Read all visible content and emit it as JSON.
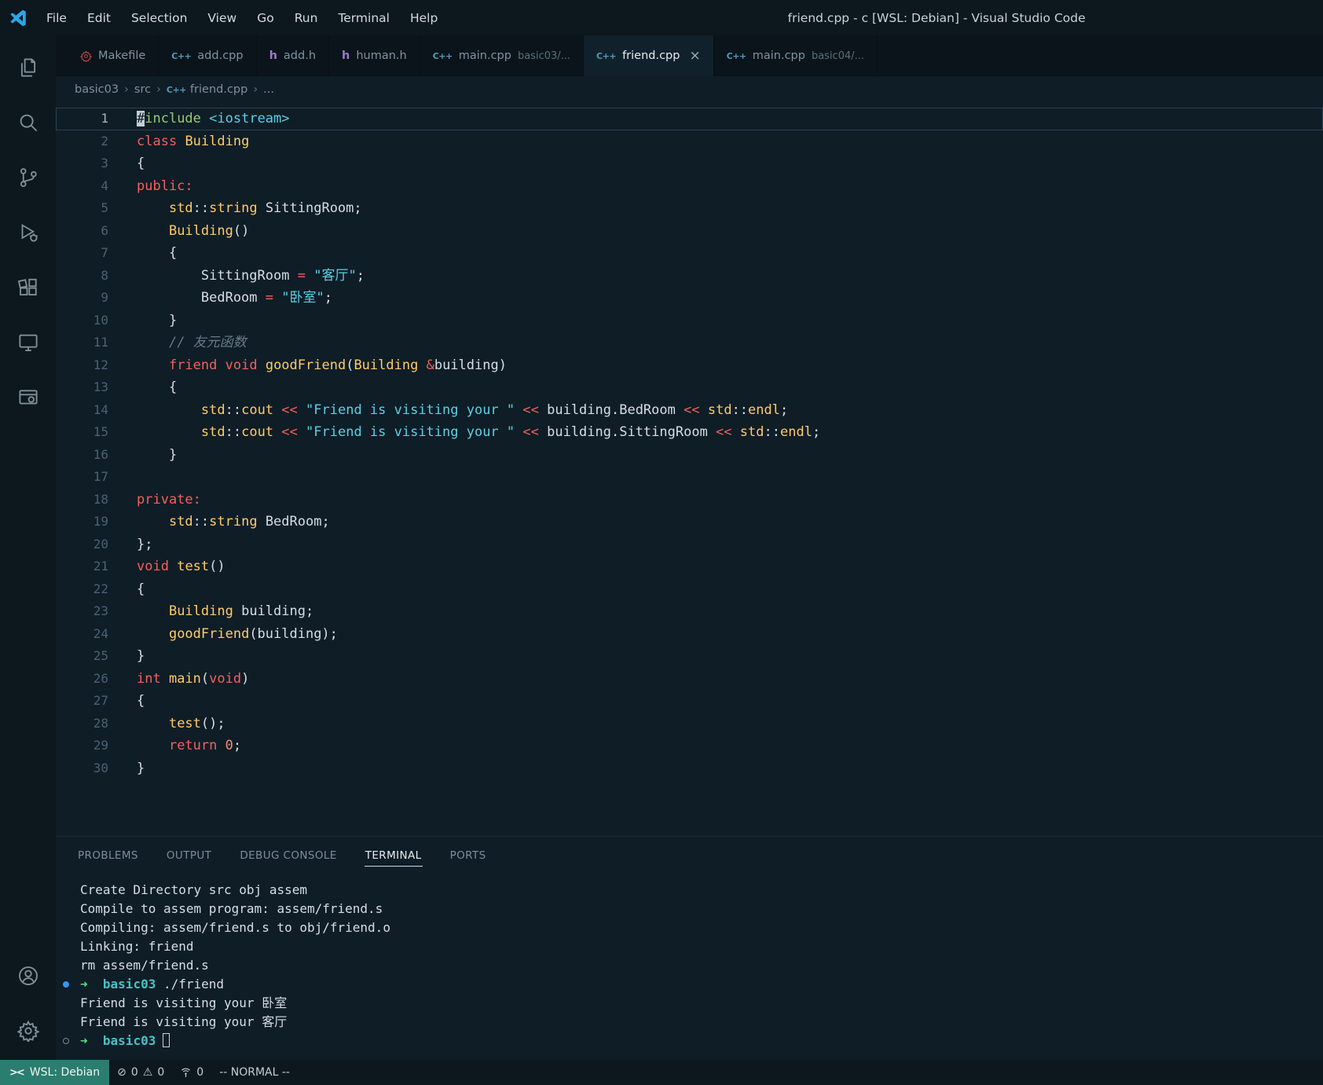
{
  "colors": {
    "accent_blue": "#3794ff",
    "remote_teal": "#2b7d6f",
    "keyword_red": "#f3605f",
    "type_gold": "#ffcb6b",
    "string_cyan": "#5bd1e6",
    "preproc_green": "#96c97c",
    "comment_gray": "#67798a",
    "number_orange": "#f78c6c",
    "cpp_icon_blue": "#519aba",
    "h_icon_purple": "#9b7cc8",
    "makefile_icon_red": "#cc4b4b",
    "prompt_green": "#54e08a",
    "prompt_cyan": "#48c2c5"
  },
  "title_bar": {
    "title": "friend.cpp - c [WSL: Debian] - Visual Studio Code",
    "menus": [
      {
        "label": "File"
      },
      {
        "label": "Edit"
      },
      {
        "label": "Selection"
      },
      {
        "label": "View"
      },
      {
        "label": "Go"
      },
      {
        "label": "Run"
      },
      {
        "label": "Terminal"
      },
      {
        "label": "Help"
      }
    ]
  },
  "tabs": [
    {
      "label": "Makefile",
      "icon": "makefile",
      "suffix": "",
      "active": false
    },
    {
      "label": "add.cpp",
      "icon": "cpp",
      "suffix": "",
      "active": false
    },
    {
      "label": "add.h",
      "icon": "h",
      "suffix": "",
      "active": false
    },
    {
      "label": "human.h",
      "icon": "h",
      "suffix": "",
      "active": false
    },
    {
      "label": "main.cpp",
      "icon": "cpp",
      "suffix": "basic03/...",
      "active": false
    },
    {
      "label": "friend.cpp",
      "icon": "cpp",
      "suffix": "",
      "active": true,
      "close": "×"
    },
    {
      "label": "main.cpp",
      "icon": "cpp",
      "suffix": "basic04/...",
      "active": false
    }
  ],
  "breadcrumb": [
    {
      "label": "basic03",
      "icon": null
    },
    {
      "label": "src",
      "icon": null
    },
    {
      "label": "friend.cpp",
      "icon": "cpp"
    },
    {
      "label": "...",
      "icon": null
    }
  ],
  "editor": {
    "lines": [
      {
        "n": 1,
        "current": true,
        "tokens": [
          [
            "cur",
            "#"
          ],
          [
            "pre",
            "include"
          ],
          [
            "pl",
            " "
          ],
          [
            "str",
            "<iostream>"
          ]
        ]
      },
      {
        "n": 2,
        "tokens": [
          [
            "kw",
            "class"
          ],
          [
            "pl",
            " "
          ],
          [
            "fn",
            "Building"
          ]
        ]
      },
      {
        "n": 3,
        "tokens": [
          [
            "pl",
            "{"
          ]
        ]
      },
      {
        "n": 4,
        "tokens": [
          [
            "kw",
            "public:"
          ]
        ]
      },
      {
        "n": 5,
        "tokens": [
          [
            "pl",
            "    "
          ],
          [
            "fn",
            "std"
          ],
          [
            "pl",
            "::"
          ],
          [
            "fn",
            "string"
          ],
          [
            "pl",
            " SittingRoom;"
          ]
        ]
      },
      {
        "n": 6,
        "tokens": [
          [
            "pl",
            "    "
          ],
          [
            "fn",
            "Building"
          ],
          [
            "pl",
            "()"
          ]
        ]
      },
      {
        "n": 7,
        "tokens": [
          [
            "pl",
            "    {"
          ]
        ]
      },
      {
        "n": 8,
        "tokens": [
          [
            "pl",
            "        SittingRoom "
          ],
          [
            "kw",
            "="
          ],
          [
            "pl",
            " "
          ],
          [
            "str",
            "\"客厅\""
          ],
          [
            "pl",
            ";"
          ]
        ]
      },
      {
        "n": 9,
        "tokens": [
          [
            "pl",
            "        BedRoom "
          ],
          [
            "kw",
            "="
          ],
          [
            "pl",
            " "
          ],
          [
            "str",
            "\"卧室\""
          ],
          [
            "pl",
            ";"
          ]
        ]
      },
      {
        "n": 10,
        "tokens": [
          [
            "pl",
            "    }"
          ]
        ]
      },
      {
        "n": 11,
        "tokens": [
          [
            "pl",
            "    "
          ],
          [
            "cmt",
            "// 友元函数"
          ]
        ]
      },
      {
        "n": 12,
        "tokens": [
          [
            "pl",
            "    "
          ],
          [
            "kw",
            "friend"
          ],
          [
            "pl",
            " "
          ],
          [
            "kw",
            "void"
          ],
          [
            "pl",
            " "
          ],
          [
            "fn",
            "goodFriend"
          ],
          [
            "pl",
            "("
          ],
          [
            "fn",
            "Building"
          ],
          [
            "pl",
            " "
          ],
          [
            "kw",
            "&"
          ],
          [
            "pl",
            "building)"
          ]
        ]
      },
      {
        "n": 13,
        "tokens": [
          [
            "pl",
            "    {"
          ]
        ]
      },
      {
        "n": 14,
        "tokens": [
          [
            "pl",
            "        "
          ],
          [
            "fn",
            "std"
          ],
          [
            "pl",
            "::"
          ],
          [
            "fn",
            "cout"
          ],
          [
            "pl",
            " "
          ],
          [
            "kw",
            "<<"
          ],
          [
            "pl",
            " "
          ],
          [
            "str",
            "\"Friend is visiting your \""
          ],
          [
            "pl",
            " "
          ],
          [
            "kw",
            "<<"
          ],
          [
            "pl",
            " building.BedRoom "
          ],
          [
            "kw",
            "<<"
          ],
          [
            "pl",
            " "
          ],
          [
            "fn",
            "std"
          ],
          [
            "pl",
            "::"
          ],
          [
            "fn",
            "endl"
          ],
          [
            "pl",
            ";"
          ]
        ]
      },
      {
        "n": 15,
        "tokens": [
          [
            "pl",
            "        "
          ],
          [
            "fn",
            "std"
          ],
          [
            "pl",
            "::"
          ],
          [
            "fn",
            "cout"
          ],
          [
            "pl",
            " "
          ],
          [
            "kw",
            "<<"
          ],
          [
            "pl",
            " "
          ],
          [
            "str",
            "\"Friend is visiting your \""
          ],
          [
            "pl",
            " "
          ],
          [
            "kw",
            "<<"
          ],
          [
            "pl",
            " building.SittingRoom "
          ],
          [
            "kw",
            "<<"
          ],
          [
            "pl",
            " "
          ],
          [
            "fn",
            "std"
          ],
          [
            "pl",
            "::"
          ],
          [
            "fn",
            "endl"
          ],
          [
            "pl",
            ";"
          ]
        ]
      },
      {
        "n": 16,
        "tokens": [
          [
            "pl",
            "    }"
          ]
        ]
      },
      {
        "n": 17,
        "tokens": []
      },
      {
        "n": 18,
        "tokens": [
          [
            "kw",
            "private:"
          ]
        ]
      },
      {
        "n": 19,
        "tokens": [
          [
            "pl",
            "    "
          ],
          [
            "fn",
            "std"
          ],
          [
            "pl",
            "::"
          ],
          [
            "fn",
            "string"
          ],
          [
            "pl",
            " BedRoom;"
          ]
        ]
      },
      {
        "n": 20,
        "tokens": [
          [
            "pl",
            "};"
          ]
        ]
      },
      {
        "n": 21,
        "tokens": [
          [
            "kw",
            "void"
          ],
          [
            "pl",
            " "
          ],
          [
            "fn",
            "test"
          ],
          [
            "pl",
            "()"
          ]
        ]
      },
      {
        "n": 22,
        "tokens": [
          [
            "pl",
            "{"
          ]
        ]
      },
      {
        "n": 23,
        "tokens": [
          [
            "pl",
            "    "
          ],
          [
            "fn",
            "Building"
          ],
          [
            "pl",
            " building;"
          ]
        ]
      },
      {
        "n": 24,
        "tokens": [
          [
            "pl",
            "    "
          ],
          [
            "fn",
            "goodFriend"
          ],
          [
            "pl",
            "(building);"
          ]
        ]
      },
      {
        "n": 25,
        "tokens": [
          [
            "pl",
            "}"
          ]
        ]
      },
      {
        "n": 26,
        "tokens": [
          [
            "kw",
            "int"
          ],
          [
            "pl",
            " "
          ],
          [
            "fn",
            "main"
          ],
          [
            "pl",
            "("
          ],
          [
            "kw",
            "void"
          ],
          [
            "pl",
            ")"
          ]
        ]
      },
      {
        "n": 27,
        "tokens": [
          [
            "pl",
            "{"
          ]
        ]
      },
      {
        "n": 28,
        "tokens": [
          [
            "pl",
            "    "
          ],
          [
            "fn",
            "test"
          ],
          [
            "pl",
            "();"
          ]
        ]
      },
      {
        "n": 29,
        "tokens": [
          [
            "pl",
            "    "
          ],
          [
            "kw",
            "return"
          ],
          [
            "pl",
            " "
          ],
          [
            "num",
            "0"
          ],
          [
            "pl",
            ";"
          ]
        ]
      },
      {
        "n": 30,
        "tokens": [
          [
            "pl",
            "}"
          ]
        ]
      }
    ]
  },
  "panel": {
    "tabs": [
      {
        "label": "PROBLEMS",
        "active": false
      },
      {
        "label": "OUTPUT",
        "active": false
      },
      {
        "label": "DEBUG CONSOLE",
        "active": false
      },
      {
        "label": "TERMINAL",
        "active": true
      },
      {
        "label": "PORTS",
        "active": false
      }
    ],
    "terminal_lines": [
      {
        "deco": null,
        "tokens": [
          [
            "pl",
            "Create Directory src obj assem"
          ]
        ]
      },
      {
        "deco": null,
        "tokens": [
          [
            "pl",
            "Compile to assem program: assem/friend.s"
          ]
        ]
      },
      {
        "deco": null,
        "tokens": [
          [
            "pl",
            "Compiling: assem/friend.s to obj/friend.o"
          ]
        ]
      },
      {
        "deco": null,
        "tokens": [
          [
            "pl",
            "Linking: friend"
          ]
        ]
      },
      {
        "deco": null,
        "tokens": [
          [
            "pl",
            "rm assem/friend.s"
          ]
        ]
      },
      {
        "deco": "filled",
        "tokens": [
          [
            "arrow",
            "➜"
          ],
          [
            "pl",
            "  "
          ],
          [
            "dir",
            "basic03"
          ],
          [
            "pl",
            " ./friend"
          ]
        ]
      },
      {
        "deco": null,
        "tokens": [
          [
            "pl",
            "Friend is visiting your 卧室"
          ]
        ]
      },
      {
        "deco": null,
        "tokens": [
          [
            "pl",
            "Friend is visiting your 客厅"
          ]
        ]
      },
      {
        "deco": "hollow",
        "tokens": [
          [
            "arrow",
            "➜"
          ],
          [
            "pl",
            "  "
          ],
          [
            "dir",
            "basic03"
          ],
          [
            "cursor",
            ""
          ]
        ]
      }
    ]
  },
  "status_bar": {
    "remote_label": "WSL: Debian",
    "errors": "0",
    "warnings": "0",
    "ports": "0",
    "mode": "-- NORMAL --"
  },
  "activity_bar": {
    "top": [
      "explorer",
      "search",
      "source-control",
      "run-and-debug",
      "extensions",
      "remote-explorer",
      "window-settings"
    ],
    "bottom": [
      "account",
      "settings"
    ]
  }
}
